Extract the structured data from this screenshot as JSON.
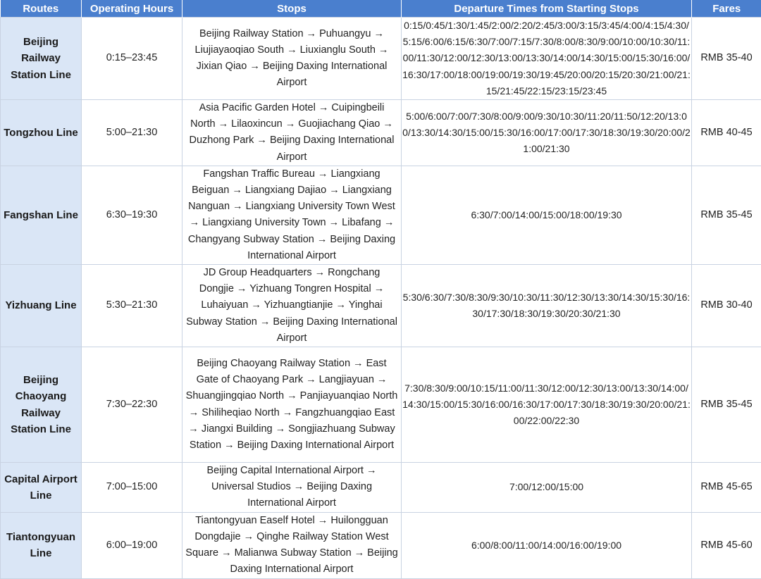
{
  "headers": {
    "routes": "Routes",
    "hours": "Operating Hours",
    "stops": "Stops",
    "times": "Departure Times from Starting Stops",
    "fares": "Fares"
  },
  "rows": [
    {
      "route": "Beijing Railway Station Line",
      "hours": "0:15–23:45",
      "stops": "Beijing Railway Station → Puhuangyu → Liujiayaoqiao South → Liuxianglu South → Jixian Qiao → Beijing Daxing International Airport",
      "times": "0:15/0:45/1:30/1:45/2:00/2:20/2:45/3:00/3:15/3:45/4:00/4:15/4:30/5:15/6:00/6:15/6:30/7:00/7:15/7:30/8:00/8:30/9:00/10:00/10:30/11:00/11:30/12:00/12:30/13:00/13:30/14:00/14:30/15:00/15:30/16:00/16:30/17:00/18:00/19:00/19:30/19:45/20:00/20:15/20:30/21:00/21:15/21:45/22:15/23:15/23:45",
      "fare": "RMB 35-40"
    },
    {
      "route": "Tongzhou Line",
      "hours": "5:00–21:30",
      "stops": "Asia Pacific Garden Hotel → Cuipingbeili North → Lilaoxincun → Guojiachang Qiao → Duzhong Park → Beijing Daxing International Airport",
      "times": "5:00/6:00/7:00/7:30/8:00/9:00/9:30/10:30/11:20/11:50/12:20/13:00/13:30/14:30/15:00/15:30/16:00/17:00/17:30/18:30/19:30/20:00/21:00/21:30",
      "fare": "RMB 40-45"
    },
    {
      "route": "Fangshan Line",
      "hours": "6:30–19:30",
      "stops": "Fangshan Traffic Bureau → Liangxiang Beiguan → Liangxiang Dajiao → Liangxiang Nanguan → Liangxiang University Town West → Liangxiang University Town → Libafang → Changyang Subway Station → Beijing Daxing International Airport",
      "times": "6:30/7:00/14:00/15:00/18:00/19:30",
      "fare": "RMB 35-45"
    },
    {
      "route": "Yizhuang Line",
      "hours": "5:30–21:30",
      "stops": "JD Group Headquarters → Rongchang Dongjie → Yizhuang Tongren Hospital → Luhaiyuan → Yizhuangtianjie → Yinghai Subway Station → Beijing Daxing International Airport",
      "times": "5:30/6:30/7:30/8:30/9:30/10:30/11:30/12:30/13:30/14:30/15:30/16:30/17:30/18:30/19:30/20:30/21:30",
      "fare": "RMB 30-40"
    },
    {
      "route": "Beijing Chaoyang Railway Station Line",
      "hours": "7:30–22:30",
      "stops": "Beijing Chaoyang Railway Station → East Gate of Chaoyang Park → Langjiayuan → Shuangjingqiao North → Panjiayuanqiao North → Shiliheqiao North → Fangzhuangqiao East → Jiangxi Building → Songjiazhuang Subway Station → Beijing Daxing International Airport",
      "times": "7:30/8:30/9:00/10:15/11:00/11:30/12:00/12:30/13:00/13:30/14:00/14:30/15:00/15:30/16:00/16:30/17:00/17:30/18:30/19:30/20:00/21:00/22:00/22:30",
      "fare": "RMB 35-45"
    },
    {
      "route": "Capital Airport Line",
      "hours": "7:00–15:00",
      "stops": "Beijing Capital International Airport → Universal Studios → Beijing Daxing International Airport",
      "times": "7:00/12:00/15:00",
      "fare": "RMB 45-65"
    },
    {
      "route": "Tiantongyuan Line",
      "hours": "6:00–19:00",
      "stops": "Tiantongyuan Eaself Hotel → Huilongguan Dongdajie → Qinghe Railway Station West Square → Malianwa Subway Station → Beijing Daxing International Airport",
      "times": "6:00/8:00/11:00/14:00/16:00/19:00",
      "fare": "RMB 45-60"
    }
  ]
}
